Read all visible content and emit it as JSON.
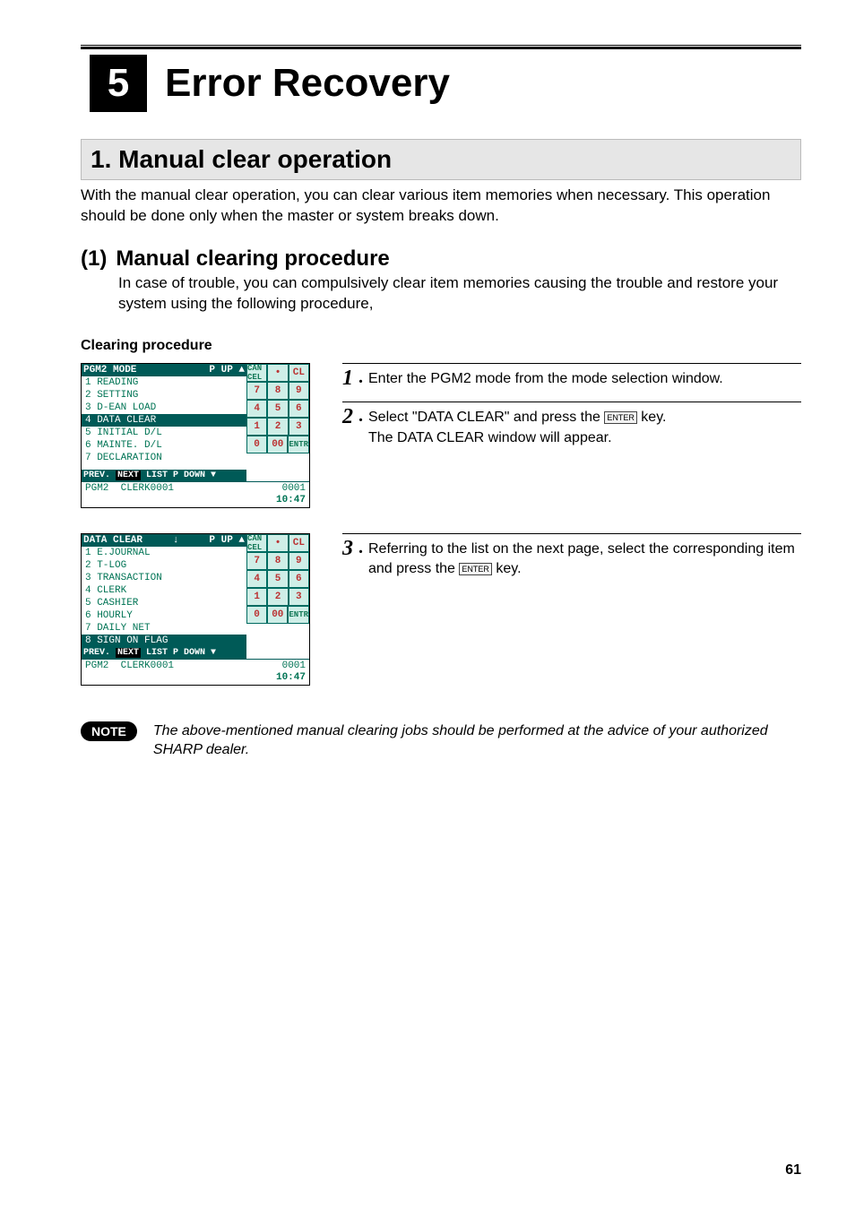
{
  "chapter": {
    "number": "5",
    "title": "Error Recovery"
  },
  "section": {
    "label": "1. Manual clear operation"
  },
  "intro": "With the manual clear operation, you can clear various item memories when necessary. This operation should be done only when the master or system breaks down.",
  "subsection": {
    "num": "(1)",
    "title": "Manual clearing procedure",
    "body": "In case of trouble, you can compulsively clear item memories causing the trouble and restore your system using the following procedure,"
  },
  "clearing_label": "Clearing procedure",
  "screen1": {
    "title_left": "PGM2 MODE",
    "title_right": "P UP ▲",
    "items": [
      {
        "n": "1",
        "t": "READING"
      },
      {
        "n": "2",
        "t": "SETTING"
      },
      {
        "n": "3",
        "t": "D-EAN LOAD"
      },
      {
        "n": "4",
        "t": "DATA CLEAR",
        "sel": true
      },
      {
        "n": "5",
        "t": "INITIAL D/L"
      },
      {
        "n": "6",
        "t": "MAINTE. D/L"
      },
      {
        "n": "7",
        "t": "DECLARATION"
      }
    ],
    "nav": [
      "PREV.",
      "NEXT",
      "LIST",
      "P DOWN ▼"
    ],
    "status_left": "PGM2",
    "status_mid": "CLERK0001",
    "status_right": "0001",
    "time": "10:47"
  },
  "screen2": {
    "title_left": "DATA CLEAR",
    "title_mid": "↓",
    "title_right": "P UP ▲",
    "items": [
      {
        "n": "1",
        "t": "E.JOURNAL"
      },
      {
        "n": "2",
        "t": "T-LOG"
      },
      {
        "n": "3",
        "t": "TRANSACTION"
      },
      {
        "n": "4",
        "t": "CLERK"
      },
      {
        "n": "5",
        "t": "CASHIER"
      },
      {
        "n": "6",
        "t": "HOURLY"
      },
      {
        "n": "7",
        "t": "DAILY NET"
      },
      {
        "n": "8",
        "t": "SIGN ON FLAG",
        "sel": true
      }
    ],
    "nav": [
      "PREV.",
      "NEXT",
      "LIST",
      "P DOWN ▼"
    ],
    "status_left": "PGM2",
    "status_mid": "CLERK0001",
    "status_right": "0001",
    "time": "10:47"
  },
  "keypad": {
    "rows": [
      [
        "CAN CEL",
        "•",
        "CL"
      ],
      [
        "7",
        "8",
        "9"
      ],
      [
        "4",
        "5",
        "6"
      ],
      [
        "1",
        "2",
        "3"
      ],
      [
        "0",
        "00",
        "ENTR"
      ]
    ]
  },
  "steps_block1": [
    {
      "num": "1",
      "text_before": "Enter the PGM2 mode from the mode selection window.",
      "key": null,
      "text_after": ""
    },
    {
      "num": "2",
      "text_before": "Select \"DATA CLEAR\" and press the ",
      "key": "ENTER",
      "text_after": " key.",
      "extra_line": "The DATA CLEAR window will appear."
    }
  ],
  "steps_block2": [
    {
      "num": "3",
      "text_before": "Referring to the list on the next page, select the corresponding item and press the ",
      "key": "ENTER",
      "text_after": " key."
    }
  ],
  "note": {
    "badge": "NOTE",
    "text": "The above-mentioned manual clearing jobs should be performed at the advice of your authorized SHARP dealer."
  },
  "page_number": "61"
}
